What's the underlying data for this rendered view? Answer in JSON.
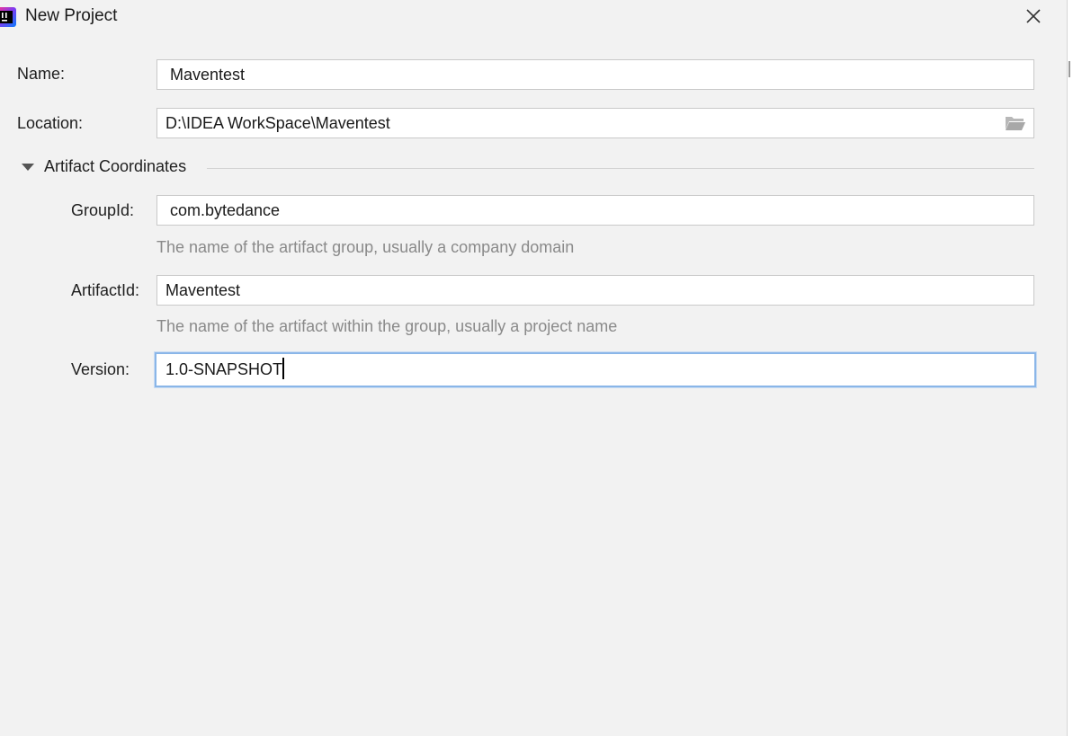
{
  "window": {
    "title": "New Project",
    "close_icon": "close-icon",
    "app_icon": "intellij-idea-icon"
  },
  "form": {
    "name": {
      "label": "Name:",
      "value": "Maventest"
    },
    "location": {
      "label": "Location:",
      "value": "D:\\IDEA WorkSpace\\Maventest",
      "browse_icon": "folder-icon"
    },
    "artifact_section": {
      "title": "Artifact Coordinates",
      "expanded": true
    },
    "group_id": {
      "label": "GroupId:",
      "value": "com.bytedance",
      "hint": "The name of the artifact group, usually a company domain"
    },
    "artifact_id": {
      "label": "ArtifactId:",
      "value": "Maventest",
      "hint": "The name of the artifact within the group, usually a project name"
    },
    "version": {
      "label": "Version:",
      "value": "1.0-SNAPSHOT",
      "focused": true
    }
  },
  "colors": {
    "background": "#f2f2f2",
    "field_background": "#ffffff",
    "field_border": "#c9c9c9",
    "focus_border": "#8ab6e8",
    "hint_text": "#8a8a8a"
  }
}
